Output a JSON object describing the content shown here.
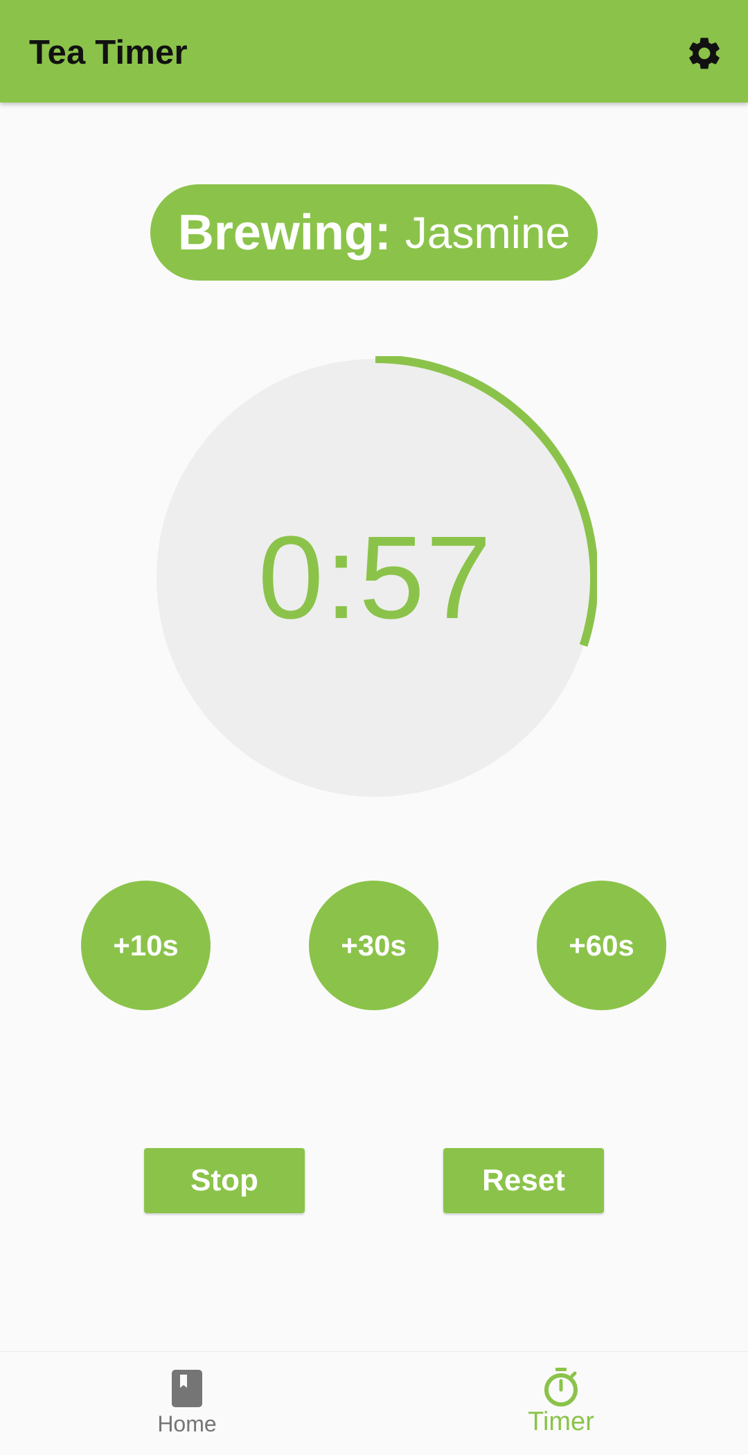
{
  "app": {
    "title": "Tea Timer",
    "settings_icon": "gear-icon"
  },
  "brewing": {
    "label": "Brewing:",
    "tea_name": "Jasmine"
  },
  "timer": {
    "display": "0:57",
    "remaining_fraction": 0.3
  },
  "add_time_buttons": [
    {
      "label": "+10s"
    },
    {
      "label": "+30s"
    },
    {
      "label": "+60s"
    }
  ],
  "controls": {
    "stop_label": "Stop",
    "reset_label": "Reset"
  },
  "bottom_nav": {
    "items": [
      {
        "label": "Home",
        "icon": "book-icon",
        "active": false
      },
      {
        "label": "Timer",
        "icon": "stopwatch-icon",
        "active": true
      }
    ]
  },
  "colors": {
    "accent": "#8bc34a",
    "ring_track": "#eeeeee",
    "inactive_nav": "#757575",
    "background": "#fafafa"
  }
}
